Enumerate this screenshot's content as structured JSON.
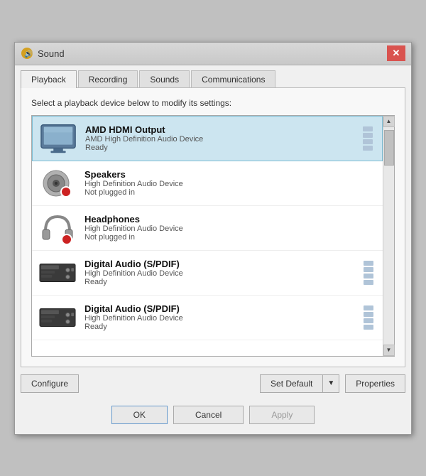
{
  "window": {
    "title": "Sound",
    "icon": "🔊"
  },
  "tabs": [
    {
      "id": "playback",
      "label": "Playback",
      "active": true
    },
    {
      "id": "recording",
      "label": "Recording",
      "active": false
    },
    {
      "id": "sounds",
      "label": "Sounds",
      "active": false
    },
    {
      "id": "communications",
      "label": "Communications",
      "active": false
    }
  ],
  "instruction": "Select a playback device below to modify its settings:",
  "devices": [
    {
      "id": "amd-hdmi",
      "name": "AMD HDMI Output",
      "desc": "AMD High Definition Audio Device",
      "status": "Ready",
      "selected": true,
      "has_bars": true,
      "has_dot": false,
      "icon_type": "hdmi"
    },
    {
      "id": "speakers",
      "name": "Speakers",
      "desc": "High Definition Audio Device",
      "status": "Not plugged in",
      "selected": false,
      "has_bars": false,
      "has_dot": true,
      "icon_type": "speakers"
    },
    {
      "id": "headphones",
      "name": "Headphones",
      "desc": "High Definition Audio Device",
      "status": "Not plugged in",
      "selected": false,
      "has_bars": false,
      "has_dot": true,
      "icon_type": "headphones"
    },
    {
      "id": "digital1",
      "name": "Digital Audio (S/PDIF)",
      "desc": "High Definition Audio Device",
      "status": "Ready",
      "selected": false,
      "has_bars": true,
      "has_dot": false,
      "icon_type": "digital"
    },
    {
      "id": "digital2",
      "name": "Digital Audio (S/PDIF)",
      "desc": "High Definition Audio Device",
      "status": "Ready",
      "selected": false,
      "has_bars": true,
      "has_dot": false,
      "icon_type": "digital"
    }
  ],
  "buttons": {
    "configure": "Configure",
    "set_default": "Set Default",
    "properties": "Properties",
    "ok": "OK",
    "cancel": "Cancel",
    "apply": "Apply"
  }
}
